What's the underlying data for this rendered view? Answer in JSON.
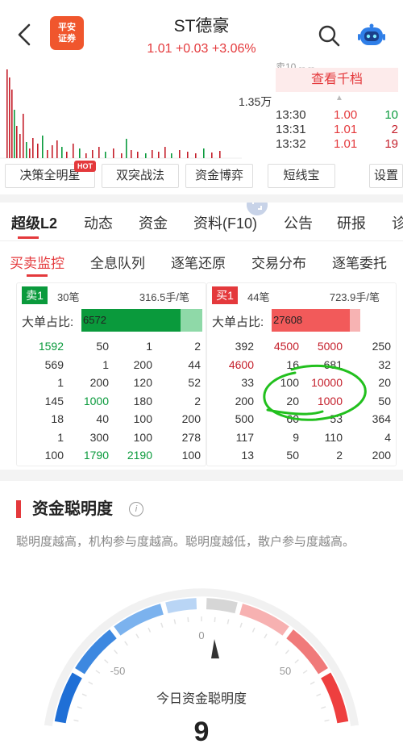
{
  "header": {
    "logo_text": "平安证券",
    "title": "ST德豪",
    "quote": "1.01 +0.03 +3.06%"
  },
  "chart": {
    "volume_label": "1.35万",
    "top_row_text": "卖10 -- --",
    "qiandang_button": "查看千档",
    "ticks": [
      {
        "time": "13:30",
        "price": "1.00",
        "vol": "10",
        "vol_color": "green"
      },
      {
        "time": "13:31",
        "price": "1.01",
        "vol": "2",
        "vol_color": "red"
      },
      {
        "time": "13:32",
        "price": "1.01",
        "vol": "19",
        "vol_color": "red"
      }
    ]
  },
  "tools": [
    "决策全明星",
    "双突战法",
    "资金博弈",
    "短线宝",
    "设置"
  ],
  "hot_badge": "HOT",
  "main_tabs": [
    "超级L2",
    "动态",
    "资金",
    "资料(F10)",
    "公告",
    "研报",
    "诊"
  ],
  "sub_tabs": [
    "买卖监控",
    "全息队列",
    "逐笔还原",
    "交易分布",
    "逐笔委托"
  ],
  "sell_panel": {
    "badge": "卖1",
    "count": "30笔",
    "avg": "316.5手/笔",
    "ratio_label": "大单占比:",
    "ratio_value": "6572",
    "ratio_fill": 0.82,
    "rows": [
      [
        {
          "v": "1592",
          "c": "green"
        },
        {
          "v": "50",
          "c": "dark"
        },
        {
          "v": "1",
          "c": "dark"
        },
        {
          "v": "2",
          "c": "dark"
        }
      ],
      [
        {
          "v": "569",
          "c": "dark"
        },
        {
          "v": "1",
          "c": "dark"
        },
        {
          "v": "200",
          "c": "dark"
        },
        {
          "v": "44",
          "c": "dark"
        }
      ],
      [
        {
          "v": "1",
          "c": "dark"
        },
        {
          "v": "200",
          "c": "dark"
        },
        {
          "v": "120",
          "c": "dark"
        },
        {
          "v": "52",
          "c": "dark"
        }
      ],
      [
        {
          "v": "145",
          "c": "dark"
        },
        {
          "v": "1000",
          "c": "green"
        },
        {
          "v": "180",
          "c": "dark"
        },
        {
          "v": "2",
          "c": "dark"
        }
      ],
      [
        {
          "v": "18",
          "c": "dark"
        },
        {
          "v": "40",
          "c": "dark"
        },
        {
          "v": "100",
          "c": "dark"
        },
        {
          "v": "200",
          "c": "dark"
        }
      ],
      [
        {
          "v": "1",
          "c": "dark"
        },
        {
          "v": "300",
          "c": "dark"
        },
        {
          "v": "100",
          "c": "dark"
        },
        {
          "v": "278",
          "c": "dark"
        }
      ],
      [
        {
          "v": "100",
          "c": "dark"
        },
        {
          "v": "1790",
          "c": "green"
        },
        {
          "v": "2190",
          "c": "green"
        },
        {
          "v": "100",
          "c": "dark"
        }
      ]
    ]
  },
  "buy_panel": {
    "badge": "买1",
    "count": "44笔",
    "avg": "723.9手/笔",
    "ratio_label": "大单占比:",
    "ratio_value": "27608",
    "ratio_fill": 0.88,
    "rows": [
      [
        {
          "v": "392",
          "c": "dark"
        },
        {
          "v": "4500",
          "c": "red"
        },
        {
          "v": "5000",
          "c": "red"
        },
        {
          "v": "250",
          "c": "dark"
        }
      ],
      [
        {
          "v": "4600",
          "c": "red"
        },
        {
          "v": "16",
          "c": "dark"
        },
        {
          "v": "681",
          "c": "dark"
        },
        {
          "v": "32",
          "c": "dark"
        }
      ],
      [
        {
          "v": "33",
          "c": "dark"
        },
        {
          "v": "100",
          "c": "dark"
        },
        {
          "v": "10000",
          "c": "red"
        },
        {
          "v": "20",
          "c": "dark"
        }
      ],
      [
        {
          "v": "200",
          "c": "dark"
        },
        {
          "v": "20",
          "c": "dark"
        },
        {
          "v": "1000",
          "c": "red"
        },
        {
          "v": "50",
          "c": "dark"
        }
      ],
      [
        {
          "v": "500",
          "c": "dark"
        },
        {
          "v": "60",
          "c": "dark"
        },
        {
          "v": "53",
          "c": "dark"
        },
        {
          "v": "364",
          "c": "dark"
        }
      ],
      [
        {
          "v": "117",
          "c": "dark"
        },
        {
          "v": "9",
          "c": "dark"
        },
        {
          "v": "110",
          "c": "dark"
        },
        {
          "v": "4",
          "c": "dark"
        }
      ],
      [
        {
          "v": "13",
          "c": "dark"
        },
        {
          "v": "50",
          "c": "dark"
        },
        {
          "v": "2",
          "c": "dark"
        },
        {
          "v": "200",
          "c": "dark"
        }
      ]
    ]
  },
  "clarity": {
    "title": "资金聪明度",
    "desc": "聪明度越高，机构参与度越高。聪明度越低，散户参与度越高。",
    "gauge_labels": {
      "min": "-50",
      "mid": "0",
      "max": "50"
    },
    "caption": "今日资金聪明度",
    "value": "9"
  },
  "colors": {
    "accent_red": "#e4393c",
    "up_red": "#c41e2a",
    "down_green": "#0a9a3c",
    "gauge_blue": "#2f86d8",
    "gauge_red": "#ee3f3f"
  },
  "icons": [
    "back-arrow-icon",
    "search-icon",
    "robot-icon",
    "expand-icon",
    "info-icon",
    "needle-icon"
  ]
}
